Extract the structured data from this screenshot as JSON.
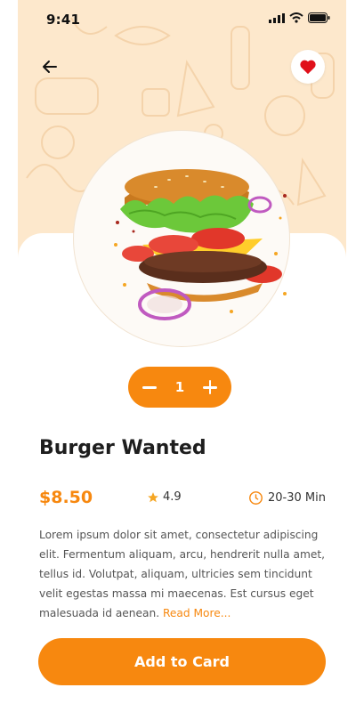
{
  "status_bar": {
    "time": "9:41"
  },
  "product": {
    "name": "Burger Wanted",
    "price": "$8.50",
    "rating": "4.9",
    "delivery_time": "20-30 Min",
    "description": "Lorem ipsum dolor sit amet, consectetur adipiscing elit. Fermentum aliquam, arcu, hendrerit nulla amet, tellus id. Volutpat, aliquam, ultricies sem tincidunt velit egestas massa mi maecenas. Est cursus eget malesuada id aenean.",
    "read_more": "Read More..."
  },
  "quantity": {
    "value": "1"
  },
  "actions": {
    "add_to_cart_label": "Add to Card"
  },
  "icons": {
    "back": "arrow-left-icon",
    "favorite": "heart-icon",
    "star": "star-icon",
    "clock": "clock-icon"
  },
  "colors": {
    "accent": "#f7880f",
    "hero_background": "#fde8cc",
    "favorite": "#e0101a",
    "star": "#f5a623"
  }
}
